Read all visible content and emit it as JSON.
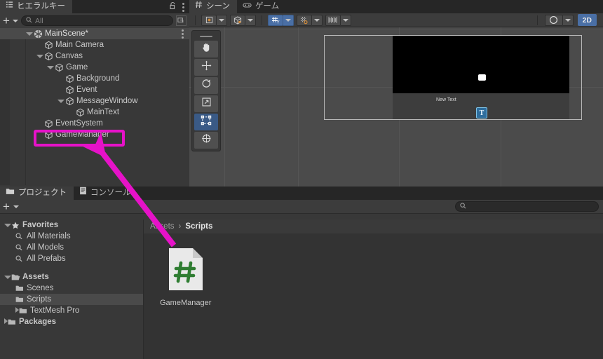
{
  "hierarchy": {
    "tab_label": "ヒエラルキー",
    "tab_icon": "hierarchy-icon",
    "lock_icon": "lock-open-icon",
    "menu_icon": "kebab-menu-icon",
    "add_label": "+",
    "search_placeholder": "All",
    "search_icon": "search-icon",
    "visibility_icon": "window-picker-icon",
    "scene": {
      "label": "MainScene*",
      "icon": "unity-scene-icon",
      "expanded": true
    },
    "items": [
      {
        "label": "Main Camera",
        "depth": 1,
        "expandable": false,
        "expanded": false
      },
      {
        "label": "Canvas",
        "depth": 1,
        "expandable": true,
        "expanded": true
      },
      {
        "label": "Game",
        "depth": 2,
        "expandable": true,
        "expanded": true
      },
      {
        "label": "Background",
        "depth": 3,
        "expandable": false,
        "expanded": false
      },
      {
        "label": "Event",
        "depth": 3,
        "expandable": false,
        "expanded": false
      },
      {
        "label": "MessageWindow",
        "depth": 3,
        "expandable": true,
        "expanded": true
      },
      {
        "label": "MainText",
        "depth": 4,
        "expandable": false,
        "expanded": false
      },
      {
        "label": "EventSystem",
        "depth": 1,
        "expandable": false,
        "expanded": false
      },
      {
        "label": "GameManager",
        "depth": 1,
        "expandable": false,
        "expanded": false
      }
    ]
  },
  "scene_view": {
    "tabs": [
      {
        "label": "シーン",
        "icon": "grid-scene-icon",
        "active": true
      },
      {
        "label": "ゲーム",
        "icon": "gamepad-icon",
        "active": false
      }
    ],
    "toolbar": {
      "pivot_icon": "pivot-center-icon",
      "handle_icon": "local-global-cube-icon",
      "grid_snap_icon": "grid-axis-y-icon",
      "snap_increment_icon": "grid-snap-icon",
      "ruler_icon": "ruler-icon",
      "shading_icon": "lighting-sphere-icon",
      "mode_2d_label": "2D"
    },
    "tool_palette": [
      {
        "name": "hand-tool",
        "icon": "hand-icon",
        "selected": false
      },
      {
        "name": "move-tool",
        "icon": "move-arrows-icon",
        "selected": false
      },
      {
        "name": "rotate-tool",
        "icon": "rotate-icon",
        "selected": false
      },
      {
        "name": "scale-tool",
        "icon": "scale-icon",
        "selected": false
      },
      {
        "name": "rect-tool",
        "icon": "rect-transform-icon",
        "selected": true
      },
      {
        "name": "transform-tool",
        "icon": "transform-icon",
        "selected": false
      }
    ],
    "canvas_text": "New Text",
    "text_gizmo_label": "T"
  },
  "project": {
    "tabs": [
      {
        "label": "プロジェクト",
        "icon": "folder-icon",
        "active": true
      },
      {
        "label": "コンソール",
        "icon": "console-icon",
        "active": false
      }
    ],
    "add_label": "+",
    "search_placeholder": "",
    "search_icon": "search-icon",
    "tree": [
      {
        "label": "Favorites",
        "depth": 0,
        "icon": "star-icon",
        "expandable": true,
        "expanded": true,
        "selected": false,
        "bold": true
      },
      {
        "label": "All Materials",
        "depth": 1,
        "icon": "search-icon",
        "expandable": false,
        "expanded": false,
        "selected": false,
        "bold": false
      },
      {
        "label": "All Models",
        "depth": 1,
        "icon": "search-icon",
        "expandable": false,
        "expanded": false,
        "selected": false,
        "bold": false
      },
      {
        "label": "All Prefabs",
        "depth": 1,
        "icon": "search-icon",
        "expandable": false,
        "expanded": false,
        "selected": false,
        "bold": false
      },
      {
        "label": "",
        "depth": 0,
        "icon": "spacer",
        "expandable": false,
        "expanded": false,
        "selected": false,
        "bold": false
      },
      {
        "label": "Assets",
        "depth": 0,
        "icon": "folder-open-icon",
        "expandable": true,
        "expanded": true,
        "selected": false,
        "bold": true
      },
      {
        "label": "Scenes",
        "depth": 1,
        "icon": "folder-icon",
        "expandable": false,
        "expanded": false,
        "selected": false,
        "bold": false
      },
      {
        "label": "Scripts",
        "depth": 1,
        "icon": "folder-icon",
        "expandable": false,
        "expanded": false,
        "selected": true,
        "bold": false
      },
      {
        "label": "TextMesh Pro",
        "depth": 1,
        "icon": "folder-icon",
        "expandable": true,
        "expanded": false,
        "selected": false,
        "bold": false
      },
      {
        "label": "Packages",
        "depth": 0,
        "icon": "folder-icon",
        "expandable": true,
        "expanded": false,
        "selected": false,
        "bold": true
      }
    ],
    "breadcrumb": {
      "root": "Assets",
      "separator": "›",
      "current": "Scripts"
    },
    "assets": [
      {
        "label": "GameManager",
        "icon": "csharp-script-icon"
      }
    ]
  },
  "annotation": {
    "color": "#e612c8",
    "highlight_target": "GameManager",
    "arrow_from": "csharp-script-icon",
    "arrow_to": "hierarchy-gamemanager-row"
  }
}
